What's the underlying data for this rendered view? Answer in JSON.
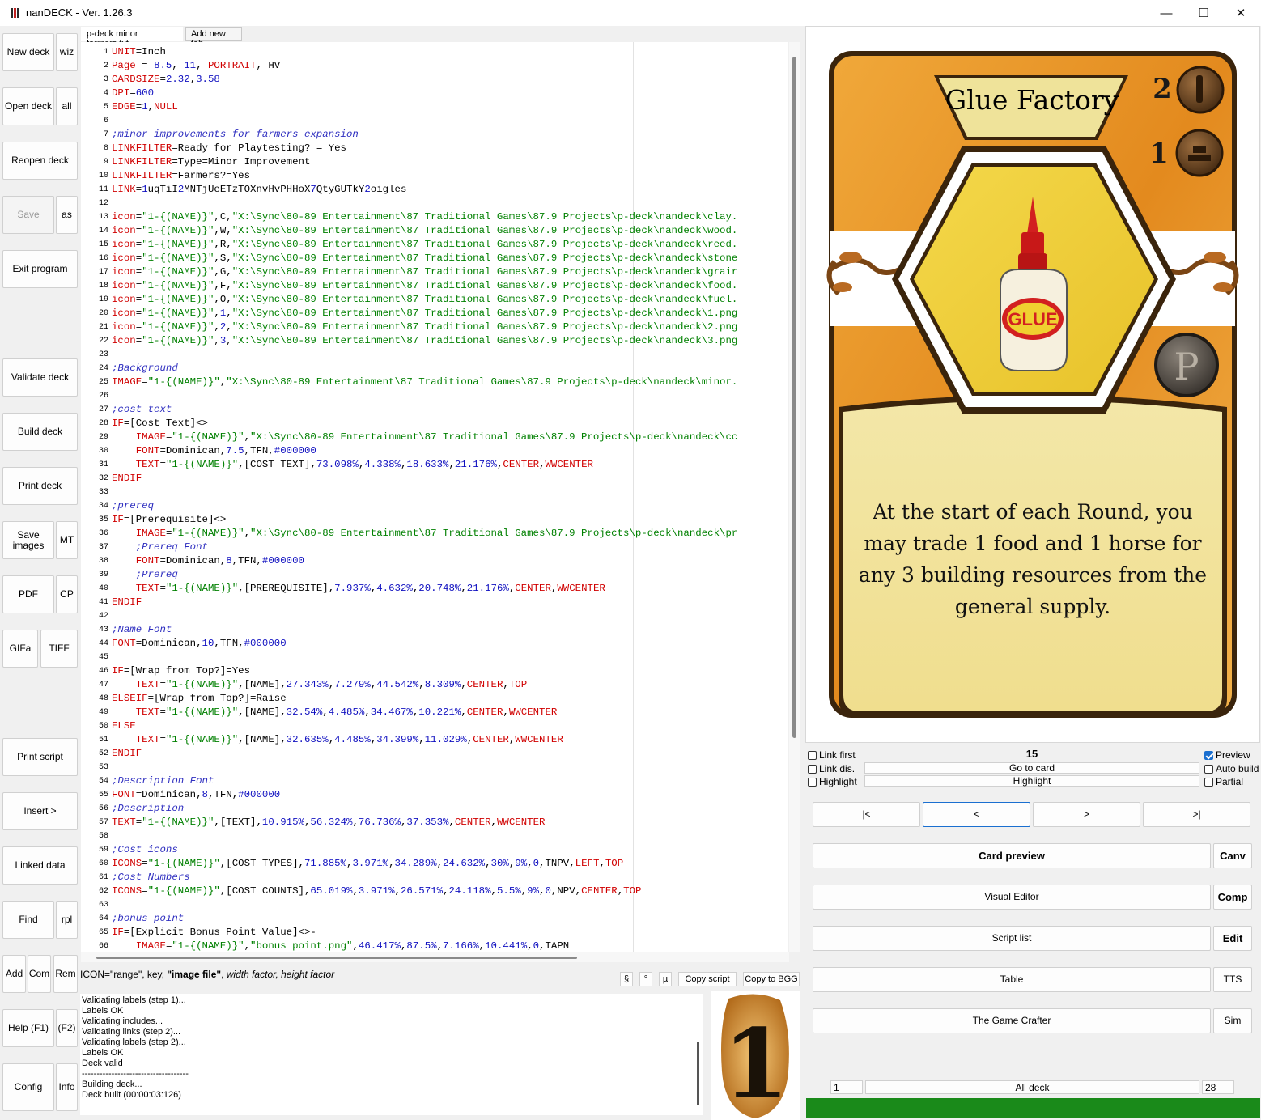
{
  "window": {
    "title": "nanDECK - Ver. 1.26.3",
    "minimize": "—",
    "maximize": "☐",
    "close": "✕"
  },
  "sidebar": {
    "new_deck": "New deck",
    "wiz": "wiz",
    "open_deck": "Open deck",
    "all": "all",
    "reopen_deck": "Reopen deck",
    "save": "Save",
    "as": "as",
    "exit_program": "Exit program",
    "validate_deck": "Validate deck",
    "build_deck": "Build deck",
    "print_deck": "Print deck",
    "save_images": "Save images",
    "mt": "MT",
    "pdf": "PDF",
    "cp": "CP",
    "gifa": "GIFa",
    "tiff": "TIFF",
    "print_script": "Print script",
    "insert": "Insert >",
    "linked_data": "Linked data",
    "find": "Find",
    "rpl": "rpl",
    "add": "Add",
    "com": "Com",
    "rem": "Rem",
    "help": "Help (F1)",
    "f2": "(F2)",
    "config": "Config",
    "info": "Info"
  },
  "tabs": {
    "active": "p-deck minor farmers.txt",
    "add_new": "Add new tab"
  },
  "code_lines": [
    {
      "n": "1",
      "t": "UNIT=Inch"
    },
    {
      "n": "2",
      "t": "Page = 8.5, 11, PORTRAIT, HV"
    },
    {
      "n": "3",
      "t": "CARDSIZE=2.32,3.58"
    },
    {
      "n": "4",
      "t": "DPI=600"
    },
    {
      "n": "5",
      "t": "EDGE=1,NULL"
    },
    {
      "n": "6",
      "t": ""
    },
    {
      "n": "7",
      "t": ";minor improvements for farmers expansion"
    },
    {
      "n": "8",
      "t": "LINKFILTER=Ready for Playtesting? = Yes"
    },
    {
      "n": "9",
      "t": "LINKFILTER=Type=Minor Improvement"
    },
    {
      "n": "10",
      "t": "LINKFILTER=Farmers?=Yes"
    },
    {
      "n": "11",
      "t": "LINK=1uqTiI2MNTjUeETzTOXnvHvPHHoX7QtyGUTkY2oigles"
    },
    {
      "n": "12",
      "t": ""
    },
    {
      "n": "13",
      "t": "icon=\"1-{(NAME)}\",C,\"X:\\Sync\\80-89 Entertainment\\87 Traditional Games\\87.9 Projects\\p-deck\\nandeck\\clay."
    },
    {
      "n": "14",
      "t": "icon=\"1-{(NAME)}\",W,\"X:\\Sync\\80-89 Entertainment\\87 Traditional Games\\87.9 Projects\\p-deck\\nandeck\\wood."
    },
    {
      "n": "15",
      "t": "icon=\"1-{(NAME)}\",R,\"X:\\Sync\\80-89 Entertainment\\87 Traditional Games\\87.9 Projects\\p-deck\\nandeck\\reed."
    },
    {
      "n": "16",
      "t": "icon=\"1-{(NAME)}\",S,\"X:\\Sync\\80-89 Entertainment\\87 Traditional Games\\87.9 Projects\\p-deck\\nandeck\\stone"
    },
    {
      "n": "17",
      "t": "icon=\"1-{(NAME)}\",G,\"X:\\Sync\\80-89 Entertainment\\87 Traditional Games\\87.9 Projects\\p-deck\\nandeck\\grair"
    },
    {
      "n": "18",
      "t": "icon=\"1-{(NAME)}\",F,\"X:\\Sync\\80-89 Entertainment\\87 Traditional Games\\87.9 Projects\\p-deck\\nandeck\\food."
    },
    {
      "n": "19",
      "t": "icon=\"1-{(NAME)}\",O,\"X:\\Sync\\80-89 Entertainment\\87 Traditional Games\\87.9 Projects\\p-deck\\nandeck\\fuel."
    },
    {
      "n": "20",
      "t": "icon=\"1-{(NAME)}\",1,\"X:\\Sync\\80-89 Entertainment\\87 Traditional Games\\87.9 Projects\\p-deck\\nandeck\\1.png"
    },
    {
      "n": "21",
      "t": "icon=\"1-{(NAME)}\",2,\"X:\\Sync\\80-89 Entertainment\\87 Traditional Games\\87.9 Projects\\p-deck\\nandeck\\2.png"
    },
    {
      "n": "22",
      "t": "icon=\"1-{(NAME)}\",3,\"X:\\Sync\\80-89 Entertainment\\87 Traditional Games\\87.9 Projects\\p-deck\\nandeck\\3.png"
    },
    {
      "n": "23",
      "t": ""
    },
    {
      "n": "24",
      "t": ";Background"
    },
    {
      "n": "25",
      "t": "IMAGE=\"1-{(NAME)}\",\"X:\\Sync\\80-89 Entertainment\\87 Traditional Games\\87.9 Projects\\p-deck\\nandeck\\minor."
    },
    {
      "n": "26",
      "t": ""
    },
    {
      "n": "27",
      "t": ";cost text"
    },
    {
      "n": "28",
      "t": "IF=[Cost Text]<>"
    },
    {
      "n": "29",
      "t": "    IMAGE=\"1-{(NAME)}\",\"X:\\Sync\\80-89 Entertainment\\87 Traditional Games\\87.9 Projects\\p-deck\\nandeck\\cc"
    },
    {
      "n": "30",
      "t": "    FONT=Dominican,7.5,TFN,#000000"
    },
    {
      "n": "31",
      "t": "    TEXT=\"1-{(NAME)}\",[COST TEXT],73.098%,4.338%,18.633%,21.176%,CENTER,WWCENTER"
    },
    {
      "n": "32",
      "t": "ENDIF"
    },
    {
      "n": "33",
      "t": ""
    },
    {
      "n": "34",
      "t": ";prereq"
    },
    {
      "n": "35",
      "t": "IF=[Prerequisite]<>"
    },
    {
      "n": "36",
      "t": "    IMAGE=\"1-{(NAME)}\",\"X:\\Sync\\80-89 Entertainment\\87 Traditional Games\\87.9 Projects\\p-deck\\nandeck\\pr"
    },
    {
      "n": "37",
      "t": "    ;Prereq Font"
    },
    {
      "n": "38",
      "t": "    FONT=Dominican,8,TFN,#000000"
    },
    {
      "n": "39",
      "t": "    ;Prereq"
    },
    {
      "n": "40",
      "t": "    TEXT=\"1-{(NAME)}\",[PREREQUISITE],7.937%,4.632%,20.748%,21.176%,CENTER,WWCENTER"
    },
    {
      "n": "41",
      "t": "ENDIF"
    },
    {
      "n": "42",
      "t": ""
    },
    {
      "n": "43",
      "t": ";Name Font"
    },
    {
      "n": "44",
      "t": "FONT=Dominican,10,TFN,#000000"
    },
    {
      "n": "45",
      "t": ""
    },
    {
      "n": "46",
      "t": "IF=[Wrap from Top?]=Yes"
    },
    {
      "n": "47",
      "t": "    TEXT=\"1-{(NAME)}\",[NAME],27.343%,7.279%,44.542%,8.309%,CENTER,TOP"
    },
    {
      "n": "48",
      "t": "ELSEIF=[Wrap from Top?]=Raise"
    },
    {
      "n": "49",
      "t": "    TEXT=\"1-{(NAME)}\",[NAME],32.54%,4.485%,34.467%,10.221%,CENTER,WWCENTER"
    },
    {
      "n": "50",
      "t": "ELSE"
    },
    {
      "n": "51",
      "t": "    TEXT=\"1-{(NAME)}\",[NAME],32.635%,4.485%,34.399%,11.029%,CENTER,WWCENTER"
    },
    {
      "n": "52",
      "t": "ENDIF"
    },
    {
      "n": "53",
      "t": ""
    },
    {
      "n": "54",
      "t": ";Description Font"
    },
    {
      "n": "55",
      "t": "FONT=Dominican,8,TFN,#000000"
    },
    {
      "n": "56",
      "t": ";Description"
    },
    {
      "n": "57",
      "t": "TEXT=\"1-{(NAME)}\",[TEXT],10.915%,56.324%,76.736%,37.353%,CENTER,WWCENTER"
    },
    {
      "n": "58",
      "t": ""
    },
    {
      "n": "59",
      "t": ";Cost icons"
    },
    {
      "n": "60",
      "t": "ICONS=\"1-{(NAME)}\",[COST TYPES],71.885%,3.971%,34.289%,24.632%,30%,9%,0,TNPV,LEFT,TOP"
    },
    {
      "n": "61",
      "t": ";Cost Numbers"
    },
    {
      "n": "62",
      "t": "ICONS=\"1-{(NAME)}\",[COST COUNTS],65.019%,3.971%,26.571%,24.118%,5.5%,9%,0,NPV,CENTER,TOP"
    },
    {
      "n": "63",
      "t": ""
    },
    {
      "n": "64",
      "t": ";bonus point"
    },
    {
      "n": "65",
      "t": "IF=[Explicit Bonus Point Value]<>-"
    },
    {
      "n": "66",
      "t": "    IMAGE=\"1-{(NAME)}\",\"bonus point.png\",46.417%,87.5%,7.166%,10.441%,0,TAPN"
    }
  ],
  "helpline": {
    "p1": "ICON=\"range\", key, ",
    "p2": "\"image file\"",
    "p3": ", ",
    "p4": "width factor, height factor"
  },
  "symbol_buttons": {
    "s1": "§",
    "s2": "°",
    "s3": "µ",
    "copy_script": "Copy script",
    "copy_bgg": "Copy to BGG"
  },
  "log_lines": [
    "Validating labels (step 1)...",
    "Labels OK",
    "Validating includes...",
    "Validating links (step 2)...",
    "Validating labels (step 2)...",
    "Labels OK",
    "Deck valid",
    "------------------------------------",
    "Building deck...",
    "Deck built (00:00:03:126)"
  ],
  "thumbnail": {
    "digit": "1"
  },
  "card": {
    "name": "Glue Factory",
    "cost1": "2",
    "cost2": "1",
    "glue_label": "GLUE",
    "badge": "P",
    "text": "At the start of each Round, you may trade 1 food and 1 horse for any 3 building resources from the general supply."
  },
  "preview_controls": {
    "link_first": "Link first",
    "link_dis": "Link dis.",
    "highlight_chk": "Highlight",
    "card_number": "15",
    "go_to_card": "Go to card",
    "highlight_btn": "Highlight",
    "preview": "Preview",
    "auto_build": "Auto build",
    "partial": "Partial",
    "nav_first": "|<",
    "nav_prev": "<",
    "nav_next": ">",
    "nav_last": ">|",
    "card_preview": "Card preview",
    "canv": "Canv",
    "visual_editor": "Visual Editor",
    "comp": "Comp",
    "script_list": "Script list",
    "edit": "Edit",
    "table": "Table",
    "tts": "TTS",
    "game_crafter": "The Game Crafter",
    "sim": "Sim",
    "range_from": "1",
    "all_deck": "All deck",
    "range_to": "28"
  },
  "colors": {
    "keyword": "#d00000",
    "value": "#1010c0",
    "string": "#008000",
    "comment": "#3030c0",
    "progress": "#1a8a1a"
  }
}
